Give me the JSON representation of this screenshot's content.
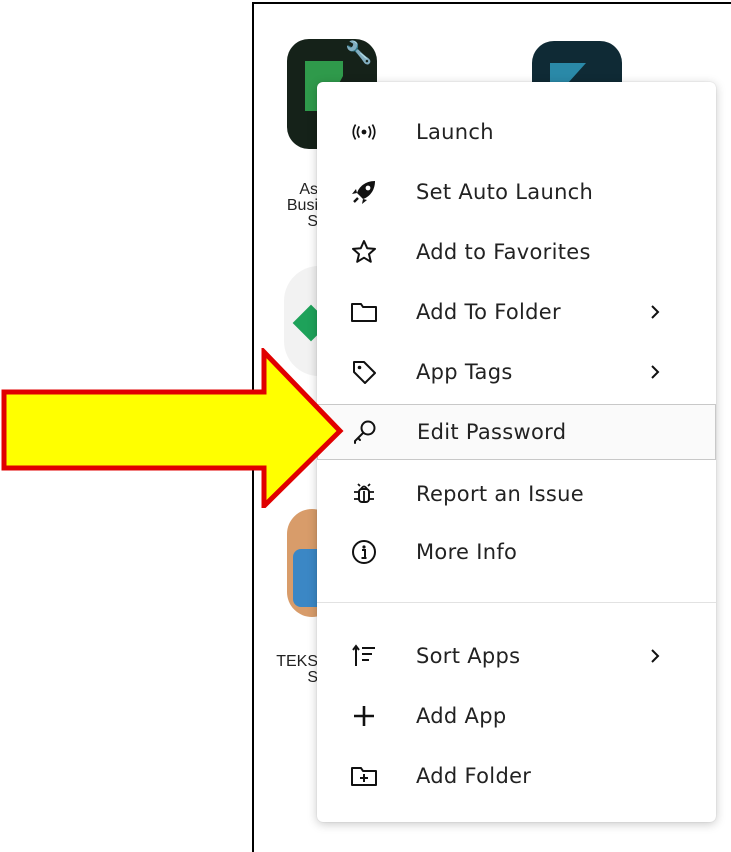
{
  "background_tiles": {
    "labels": [
      "As",
      "Busi",
      "S",
      "TEKS",
      "S"
    ]
  },
  "menu": {
    "items": [
      {
        "label": "Launch",
        "icon": "broadcast-icon",
        "has_submenu": false
      },
      {
        "label": "Set Auto Launch",
        "icon": "rocket-icon",
        "has_submenu": false
      },
      {
        "label": "Add to Favorites",
        "icon": "star-icon",
        "has_submenu": false
      },
      {
        "label": "Add To Folder",
        "icon": "folder-icon",
        "has_submenu": true
      },
      {
        "label": "App Tags",
        "icon": "tag-icon",
        "has_submenu": true
      },
      {
        "label": "Edit Password",
        "icon": "key-icon",
        "has_submenu": false,
        "highlighted": true
      },
      {
        "label": "Report an Issue",
        "icon": "bug-icon",
        "has_submenu": false
      },
      {
        "label": "More Info",
        "icon": "info-icon",
        "has_submenu": false
      },
      {
        "label": "Sort Apps",
        "icon": "sort-icon",
        "has_submenu": true
      },
      {
        "label": "Add App",
        "icon": "plus-icon",
        "has_submenu": false
      },
      {
        "label": "Add Folder",
        "icon": "folder-plus-icon",
        "has_submenu": false
      }
    ]
  },
  "annotation": {
    "arrow_fill": "#ffff00",
    "arrow_stroke": "#e00000",
    "points_to": "Edit Password"
  }
}
